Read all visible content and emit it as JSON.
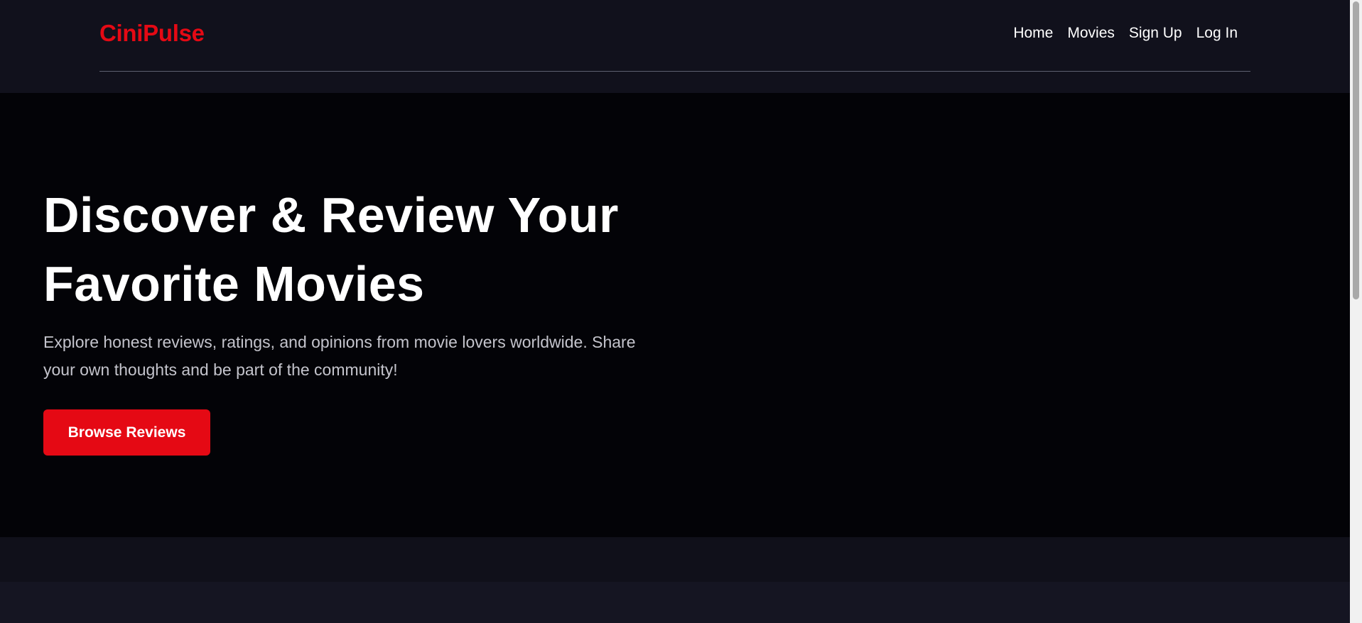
{
  "brand": {
    "name": "CiniPulse",
    "color": "#e50914"
  },
  "nav": {
    "items": [
      {
        "label": "Home"
      },
      {
        "label": "Movies"
      },
      {
        "label": "Sign Up"
      },
      {
        "label": "Log In"
      }
    ]
  },
  "hero": {
    "title_line1": "Discover & Review Your",
    "title_line2": "Favorite Movies",
    "subtitle": "Explore honest reviews, ratings, and opinions from movie lovers worldwide. Share your own thoughts and be part of the community!",
    "button_label": "Browse Reviews",
    "button_color": "#e50914"
  },
  "colors": {
    "header_bg": "#11111c",
    "hero_bg": "#030307",
    "text_primary": "#ffffff",
    "text_secondary": "#c4c4cc"
  }
}
